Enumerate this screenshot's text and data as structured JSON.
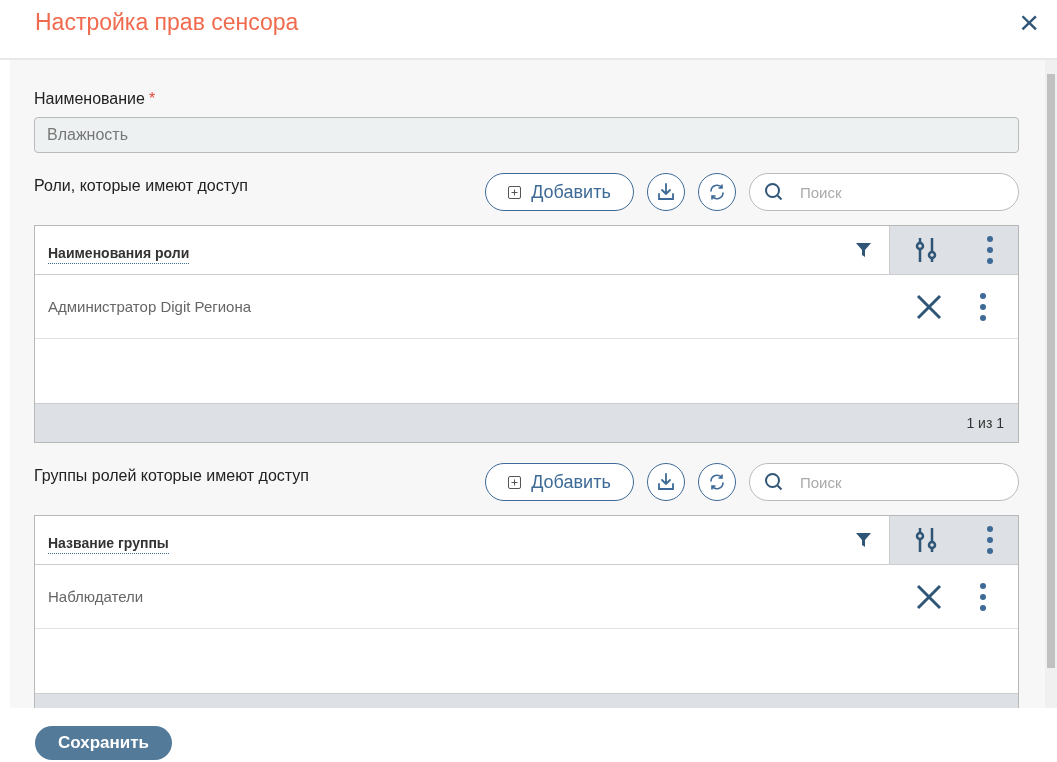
{
  "dialog": {
    "title": "Настройка прав сенсора",
    "close": "×"
  },
  "name_field": {
    "label": "Наименование",
    "required_mark": "*",
    "value": "Влажность"
  },
  "sections": [
    {
      "title": "Роли, которые имеют доступ",
      "add_button": "Добавить",
      "search": {
        "placeholder": "Поиск"
      },
      "column": "Наименования роли",
      "rows": [
        {
          "name": "Администратор Digit Региона"
        }
      ],
      "pager": "1 из 1"
    },
    {
      "title": "Группы ролей которые имеют доступ",
      "add_button": "Добавить",
      "search": {
        "placeholder": "Поиск"
      },
      "column": "Название группы",
      "rows": [
        {
          "name": "Наблюдатели"
        }
      ]
    }
  ],
  "save_button": "Сохранить"
}
